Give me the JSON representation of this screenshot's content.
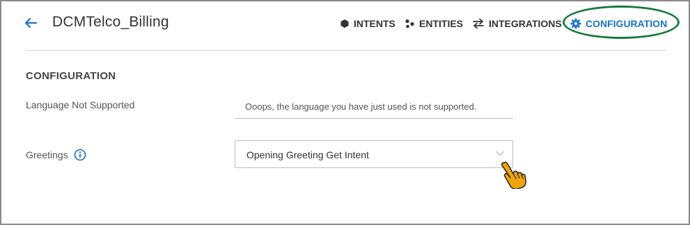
{
  "header": {
    "title": "DCMTelco_Billing",
    "nav": {
      "intents": "INTENTS",
      "entities": "ENTITIES",
      "integrations": "INTEGRATIONS",
      "configuration": "CONFIGURATION"
    }
  },
  "icons": {
    "back": "arrow-left-icon",
    "intents": "hexagon-icon",
    "entities": "dots-cluster-icon",
    "integrations": "swap-arrows-icon",
    "configuration": "gear-icon",
    "greetings_info": "info-icon",
    "select": "chevron-down-icon",
    "pointer": "hand-pointer-icon"
  },
  "colors": {
    "accent": "#1a73c8",
    "highlight": "#197a3c",
    "hand": "#f0a30a"
  },
  "main": {
    "section_title": "CONFIGURATION",
    "fields": {
      "language_not_supported": {
        "label": "Language Not Supported",
        "value": "Ooops, the language you have just used is not supported."
      },
      "greetings": {
        "label": "Greetings",
        "selected": "Opening Greeting Get Intent"
      }
    }
  }
}
